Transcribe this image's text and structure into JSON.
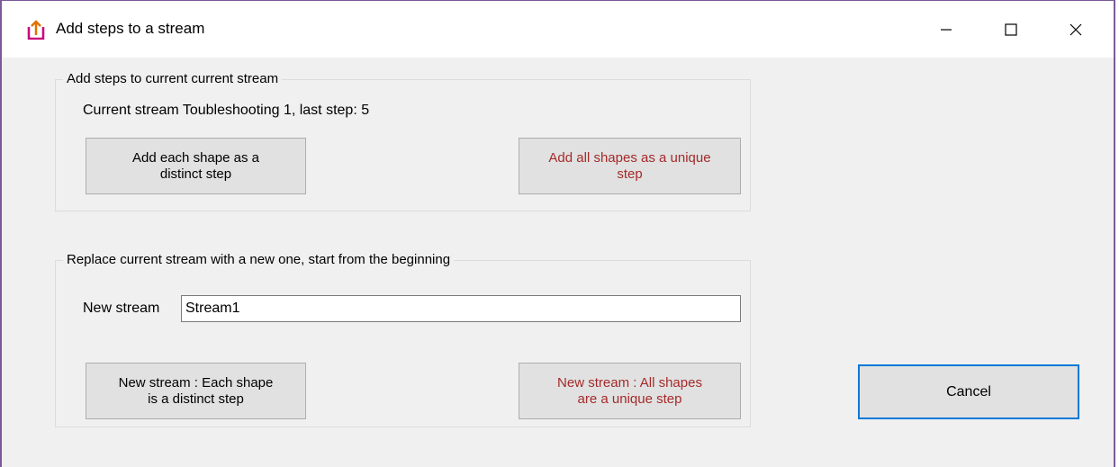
{
  "window": {
    "title": "Add steps to a stream",
    "icon": "stream-arrow-icon",
    "accent_color": "#c8007a"
  },
  "group_current": {
    "legend": "Add steps to current current stream",
    "current_stream_label": "Current stream  Toubleshooting 1, last step: 5",
    "btn_each_shape": "Add each shape as a\ndistinct step",
    "btn_all_shapes": "Add all shapes as a unique\nstep"
  },
  "group_replace": {
    "legend": "Replace current stream with a new one, start from the beginning",
    "new_stream_label": "New stream",
    "new_stream_value": "Stream1",
    "btn_new_each": "New stream : Each shape\nis a distinct step",
    "btn_new_all": "New stream : All shapes\nare a unique step"
  },
  "cancel_label": "Cancel"
}
